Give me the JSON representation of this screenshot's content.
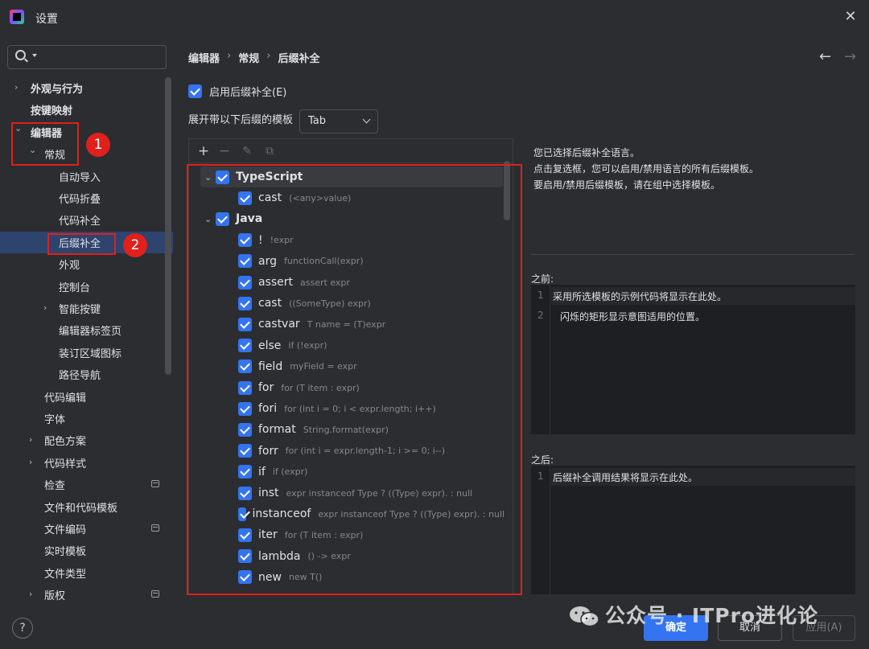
{
  "window": {
    "title": "设置",
    "close_icon": "close-icon"
  },
  "search": {
    "placeholder": "",
    "value": ""
  },
  "sidebar": {
    "items": [
      {
        "label": "外观与行为",
        "bold": true,
        "chevron": "right",
        "indent": 0
      },
      {
        "label": "按键映射",
        "bold": true,
        "chevron": "",
        "indent": 0
      },
      {
        "label": "编辑器",
        "bold": true,
        "chevron": "down",
        "indent": 0
      },
      {
        "label": "常规",
        "bold": false,
        "chevron": "down",
        "indent": 1
      },
      {
        "label": "自动导入",
        "bold": false,
        "chevron": "",
        "indent": 2
      },
      {
        "label": "代码折叠",
        "bold": false,
        "chevron": "",
        "indent": 2
      },
      {
        "label": "代码补全",
        "bold": false,
        "chevron": "",
        "indent": 2
      },
      {
        "label": "后缀补全",
        "bold": false,
        "chevron": "",
        "indent": 2,
        "selected": true
      },
      {
        "label": "外观",
        "bold": false,
        "chevron": "",
        "indent": 2
      },
      {
        "label": "控制台",
        "bold": false,
        "chevron": "",
        "indent": 2
      },
      {
        "label": "智能按键",
        "bold": false,
        "chevron": "right",
        "indent": 2
      },
      {
        "label": "编辑器标签页",
        "bold": false,
        "chevron": "",
        "indent": 2
      },
      {
        "label": "装订区域图标",
        "bold": false,
        "chevron": "",
        "indent": 2
      },
      {
        "label": "路径导航",
        "bold": false,
        "chevron": "",
        "indent": 2
      },
      {
        "label": "代码编辑",
        "bold": false,
        "chevron": "",
        "indent": 1
      },
      {
        "label": "字体",
        "bold": false,
        "chevron": "",
        "indent": 1
      },
      {
        "label": "配色方案",
        "bold": false,
        "chevron": "right",
        "indent": 1
      },
      {
        "label": "代码样式",
        "bold": false,
        "chevron": "right",
        "indent": 1
      },
      {
        "label": "检查",
        "bold": false,
        "chevron": "",
        "indent": 1,
        "mini": true
      },
      {
        "label": "文件和代码模板",
        "bold": false,
        "chevron": "",
        "indent": 1
      },
      {
        "label": "文件编码",
        "bold": false,
        "chevron": "",
        "indent": 1,
        "mini": true
      },
      {
        "label": "实时模板",
        "bold": false,
        "chevron": "",
        "indent": 1
      },
      {
        "label": "文件类型",
        "bold": false,
        "chevron": "",
        "indent": 1
      },
      {
        "label": "版权",
        "bold": false,
        "chevron": "right",
        "indent": 1,
        "mini": true
      }
    ]
  },
  "annotations": {
    "marker1": "1",
    "marker2": "2"
  },
  "breadcrumb": [
    "编辑器",
    "常规",
    "后缀补全"
  ],
  "nav": {
    "back_icon": "arrow-left-icon",
    "forward_icon": "arrow-right-icon"
  },
  "settings": {
    "enable_label": "启用后缀补全(E)",
    "enable_checked": true,
    "expand_label": "展开带以下后缀的模板",
    "expand_value": "Tab"
  },
  "toolbar_icons": [
    "add-icon",
    "remove-icon",
    "edit-icon",
    "copy-icon"
  ],
  "templates": [
    {
      "type": "group",
      "key": "TypeScript",
      "checked": true,
      "selected": true
    },
    {
      "type": "item",
      "key": "cast",
      "desc": "(<any>value)",
      "checked": true
    },
    {
      "type": "group",
      "key": "Java",
      "checked": true
    },
    {
      "type": "item",
      "key": "!",
      "desc": "!expr",
      "checked": true
    },
    {
      "type": "item",
      "key": "arg",
      "desc": "functionCall(expr)",
      "checked": true
    },
    {
      "type": "item",
      "key": "assert",
      "desc": "assert expr",
      "checked": true
    },
    {
      "type": "item",
      "key": "cast",
      "desc": "((SomeType) expr)",
      "checked": true
    },
    {
      "type": "item",
      "key": "castvar",
      "desc": "T name = (T)expr",
      "checked": true
    },
    {
      "type": "item",
      "key": "else",
      "desc": "if (!expr)",
      "checked": true
    },
    {
      "type": "item",
      "key": "field",
      "desc": "myField = expr",
      "checked": true
    },
    {
      "type": "item",
      "key": "for",
      "desc": "for (T item : expr)",
      "checked": true
    },
    {
      "type": "item",
      "key": "fori",
      "desc": "for (int i = 0; i < expr.length; i++)",
      "checked": true
    },
    {
      "type": "item",
      "key": "format",
      "desc": "String.format(expr)",
      "checked": true
    },
    {
      "type": "item",
      "key": "forr",
      "desc": "for (int i = expr.length-1; i >= 0; i--)",
      "checked": true
    },
    {
      "type": "item",
      "key": "if",
      "desc": "if (expr)",
      "checked": true
    },
    {
      "type": "item",
      "key": "inst",
      "desc": "expr instanceof Type ? ((Type) expr). : null",
      "checked": true
    },
    {
      "type": "item",
      "key": "instanceof",
      "desc": "expr instanceof Type ? ((Type) expr). : null",
      "checked": true
    },
    {
      "type": "item",
      "key": "iter",
      "desc": "for (T item : expr)",
      "checked": true
    },
    {
      "type": "item",
      "key": "lambda",
      "desc": "() -> expr",
      "checked": true
    },
    {
      "type": "item",
      "key": "new",
      "desc": "new T()",
      "checked": true
    }
  ],
  "info": {
    "line1": "您已选择后缀补全语言。",
    "line2": "点击复选框，您可以启用/禁用语言的所有后缀模板。",
    "line3": "要启用/禁用后缀模板，请在组中选择模板。"
  },
  "before": {
    "label": "之前:",
    "lines": [
      {
        "n": "1",
        "text": "采用所选模板的示例代码将显示在此处。"
      },
      {
        "n": "2",
        "text": "闪烁的矩形显示意图适用的位置。"
      }
    ]
  },
  "after": {
    "label": "之后:",
    "lines": [
      {
        "n": "1",
        "text": "后缀补全调用结果将显示在此处。"
      }
    ]
  },
  "buttons": {
    "ok": "确定",
    "cancel": "取消",
    "apply": "应用(A)"
  },
  "help_icon": "?",
  "watermark": "公众号 · ITPro进化论",
  "colors": {
    "accent": "#3574f0",
    "highlight": "#e0201c",
    "background": "#2b2d30",
    "selection": "#2e436e"
  }
}
